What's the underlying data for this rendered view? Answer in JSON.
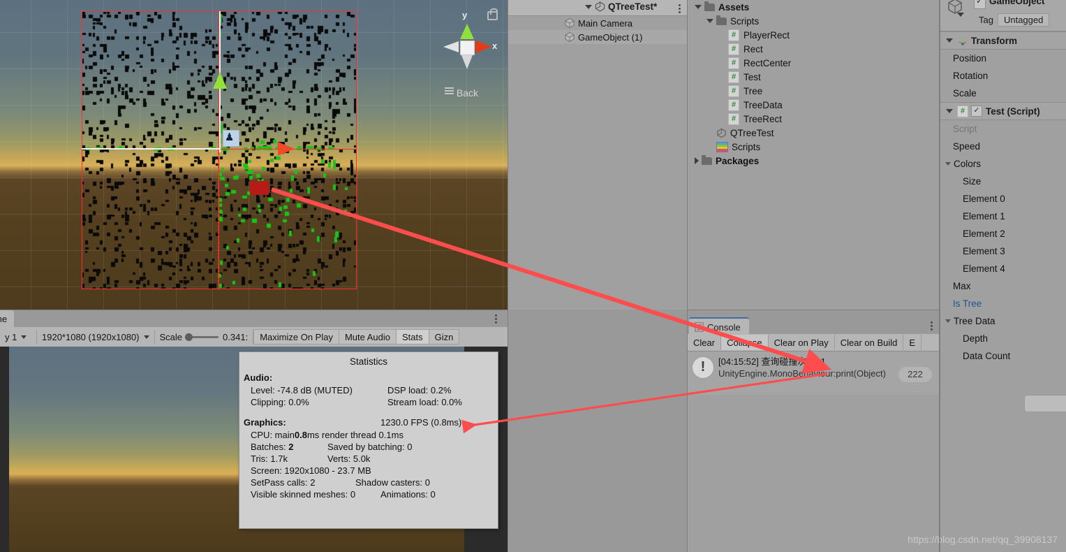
{
  "scene": {
    "gizmo": {
      "y_label": "y",
      "x_label": "x",
      "view_label": "Back",
      "lock_icon": "lock-icon"
    },
    "player_icon": "player-glyph"
  },
  "game": {
    "tab_label": "me",
    "display_value": "y 1",
    "resolution_value": "1920*1080 (1920x1080)",
    "scale_label": "Scale",
    "scale_value": "0.341:",
    "maximize_label": "Maximize On Play",
    "mute_label": "Mute Audio",
    "stats_label": "Stats",
    "gizmos_label": "Gizn",
    "menu_icon": "kebab-menu-icon"
  },
  "statistics": {
    "title": "Statistics",
    "audio_header": "Audio:",
    "audio_rows": [
      {
        "left": "Level: -74.8 dB (MUTED)",
        "right": "DSP load: 0.2%"
      },
      {
        "left": "Clipping: 0.0%",
        "right": "Stream load: 0.0%"
      }
    ],
    "graphics_header": "Graphics:",
    "fps": "1230.0 FPS (0.8ms)",
    "cpu_prefix": "CPU: main ",
    "cpu_main": "0.8",
    "cpu_suffix": "ms  render thread 0.1ms",
    "batches_label": "Batches: ",
    "batches_value": "2",
    "saved_by_batching": "Saved by batching: 0",
    "tris": "Tris: 1.7k",
    "verts": "Verts: 5.0k",
    "screen": "Screen: 1920x1080 - 23.7 MB",
    "setpass": "SetPass calls: 2",
    "shadow_casters": "Shadow casters: 0",
    "skinned_meshes": "Visible skinned meshes: 0",
    "animations": "Animations: 0"
  },
  "hierarchy": {
    "scene_name": "QTreeTest*",
    "menu_icon": "kebab-menu-icon",
    "items": [
      {
        "label": "Main Camera",
        "icon": "gameobject-cube-icon",
        "selected": false
      },
      {
        "label": "GameObject (1)",
        "icon": "gameobject-cube-icon",
        "selected": true
      }
    ]
  },
  "project": {
    "rows": [
      {
        "label": "Assets",
        "icon": "folder-icon",
        "indent": 0,
        "expanded": true,
        "bold": true
      },
      {
        "label": "Scripts",
        "icon": "folder-icon",
        "indent": 1,
        "expanded": true,
        "bold": false
      },
      {
        "label": "PlayerRect",
        "icon": "csharp-icon",
        "indent": 2,
        "expanded": null,
        "bold": false
      },
      {
        "label": "Rect",
        "icon": "csharp-icon",
        "indent": 2,
        "expanded": null,
        "bold": false
      },
      {
        "label": "RectCenter",
        "icon": "csharp-icon",
        "indent": 2,
        "expanded": null,
        "bold": false
      },
      {
        "label": "Test",
        "icon": "csharp-icon",
        "indent": 2,
        "expanded": null,
        "bold": false
      },
      {
        "label": "Tree",
        "icon": "csharp-icon",
        "indent": 2,
        "expanded": null,
        "bold": false
      },
      {
        "label": "TreeData",
        "icon": "csharp-icon",
        "indent": 2,
        "expanded": null,
        "bold": false
      },
      {
        "label": "TreeRect",
        "icon": "csharp-icon",
        "indent": 2,
        "expanded": null,
        "bold": false
      },
      {
        "label": "QTreeTest",
        "icon": "unity-scene-icon",
        "indent": 1,
        "expanded": null,
        "bold": false
      },
      {
        "label": "Scripts",
        "icon": "archive-icon",
        "indent": 1,
        "expanded": null,
        "bold": false
      },
      {
        "label": "Packages",
        "icon": "folder-icon",
        "indent": 0,
        "expanded": false,
        "bold": true
      }
    ]
  },
  "console": {
    "tab_label": "Console",
    "tab_icon": "console-icon",
    "menu_icon": "kebab-menu-icon",
    "buttons": [
      {
        "label": "Clear",
        "active": false
      },
      {
        "label": "Collapse",
        "active": true
      },
      {
        "label": "Clear on Play",
        "active": false
      },
      {
        "label": "Clear on Build",
        "active": false
      },
      {
        "label": "E",
        "active": false
      }
    ],
    "message": {
      "icon": "warning-icon",
      "line1": "[04:15:52] 查询碰撞次数21",
      "line2": "UnityEngine.MonoBehaviour:print(Object)",
      "count_badge": "222"
    }
  },
  "inspector": {
    "object_name": "GameObject",
    "object_icon": "gameobject-cube-icon",
    "enabled_checkbox": "enabled-checkbox",
    "tag_label": "Tag",
    "tag_value": "Untagged",
    "components": [
      {
        "name": "Transform",
        "icon": "transform-icon",
        "expanded": true,
        "fields": [
          {
            "label": "Position",
            "indent": 1,
            "style": "normal"
          },
          {
            "label": "Rotation",
            "indent": 1,
            "style": "normal"
          },
          {
            "label": "Scale",
            "indent": 1,
            "style": "normal"
          }
        ]
      },
      {
        "name": "Test (Script)",
        "icon": "csharp-icon",
        "has_checkbox": true,
        "expanded": true,
        "fields": [
          {
            "label": "Script",
            "indent": 1,
            "style": "dim"
          },
          {
            "label": "Speed",
            "indent": 1,
            "style": "normal"
          },
          {
            "label": "Colors",
            "indent": 0,
            "style": "normal",
            "foldout": true
          },
          {
            "label": "Size",
            "indent": 2,
            "style": "normal"
          },
          {
            "label": "Element 0",
            "indent": 2,
            "style": "normal"
          },
          {
            "label": "Element 1",
            "indent": 2,
            "style": "normal"
          },
          {
            "label": "Element 2",
            "indent": 2,
            "style": "normal"
          },
          {
            "label": "Element 3",
            "indent": 2,
            "style": "normal"
          },
          {
            "label": "Element 4",
            "indent": 2,
            "style": "normal"
          },
          {
            "label": "Max",
            "indent": 1,
            "style": "normal"
          },
          {
            "label": "Is Tree",
            "indent": 1,
            "style": "blue"
          },
          {
            "label": "Tree Data",
            "indent": 0,
            "style": "normal",
            "foldout": true
          },
          {
            "label": "Depth",
            "indent": 2,
            "style": "normal"
          },
          {
            "label": "Data Count",
            "indent": 2,
            "style": "normal"
          }
        ]
      }
    ],
    "add_component_button": "add-component-button"
  },
  "watermark": {
    "text": "https://blog.csdn.net/qq_39908137"
  },
  "colors": {
    "annotation_red": "#ff4d4d",
    "quad_red": "#ff2d2d",
    "axis_green": "#96e03a",
    "axis_red": "#f04a26",
    "panel_bg": "#a0a0a0",
    "toolbar_bg": "#b6b6b6",
    "blue_modified": "#24538f"
  }
}
